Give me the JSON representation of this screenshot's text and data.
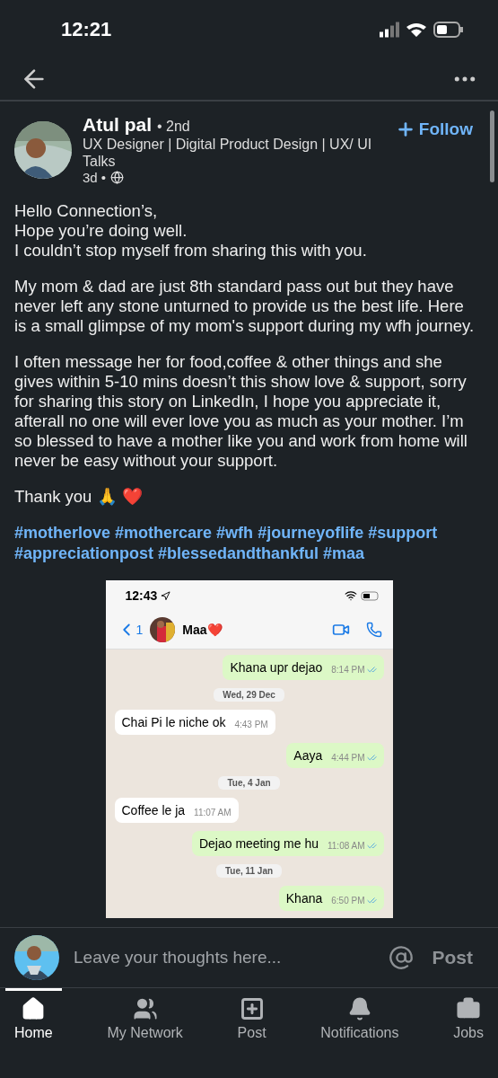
{
  "status_bar": {
    "time": "12:21"
  },
  "post": {
    "author": "Atul pal",
    "degree": "• 2nd",
    "headline": "UX Designer | Digital Product Design | UX/ UI Talks",
    "age": "3d •",
    "follow": "Follow",
    "paragraphs": [
      "Hello Connection’s,\nHope you’re doing well.\nI couldn’t stop myself from sharing this with you.",
      "My mom & dad are just 8th standard pass out but they have never left any stone unturned to provide us the best life. Here is a small glimpse of my mom's support during my wfh journey.",
      "I often message her for food,coffee & other things and she gives within 5-10 mins doesn’t this show love & support, sorry for sharing this story on LinkedIn, I hope you appreciate it, afterall no one will ever love you as much as your mother. I’m so blessed to have a mother like you and work from home will never be easy without your support.",
      "Thank you 🙏 ❤️"
    ],
    "hashtags": [
      "#motherlove",
      "#mothercare",
      "#wfh",
      "#journeyoflife",
      "#support",
      "#appreciationpost",
      "#blessedandthankful",
      "#maa"
    ],
    "chat": {
      "time": "12:43",
      "back_count": "1",
      "contact": "Maa❤️",
      "messages": [
        {
          "kind": "outgoing",
          "text": "Khana upr dejao",
          "time": "8:14 PM"
        },
        {
          "kind": "date",
          "text": "Wed, 29 Dec"
        },
        {
          "kind": "incoming",
          "text": "Chai Pi le niche ok",
          "time": "4:43 PM"
        },
        {
          "kind": "outgoing",
          "text": "Aaya",
          "time": "4:44 PM"
        },
        {
          "kind": "date",
          "text": "Tue, 4 Jan"
        },
        {
          "kind": "incoming",
          "text": "Coffee le ja",
          "time": "11:07 AM"
        },
        {
          "kind": "outgoing",
          "text": "Dejao meeting me hu",
          "time": "11:08 AM"
        },
        {
          "kind": "date",
          "text": "Tue, 11 Jan"
        },
        {
          "kind": "outgoing",
          "text": "Khana",
          "time": "6:50 PM"
        }
      ]
    }
  },
  "comment_bar": {
    "placeholder": "Leave your thoughts here...",
    "post": "Post"
  },
  "nav": [
    {
      "label": "Home",
      "selected": true
    },
    {
      "label": "My Network",
      "selected": false
    },
    {
      "label": "Post",
      "selected": false
    },
    {
      "label": "Notifications",
      "selected": false
    },
    {
      "label": "Jobs",
      "selected": false
    }
  ]
}
